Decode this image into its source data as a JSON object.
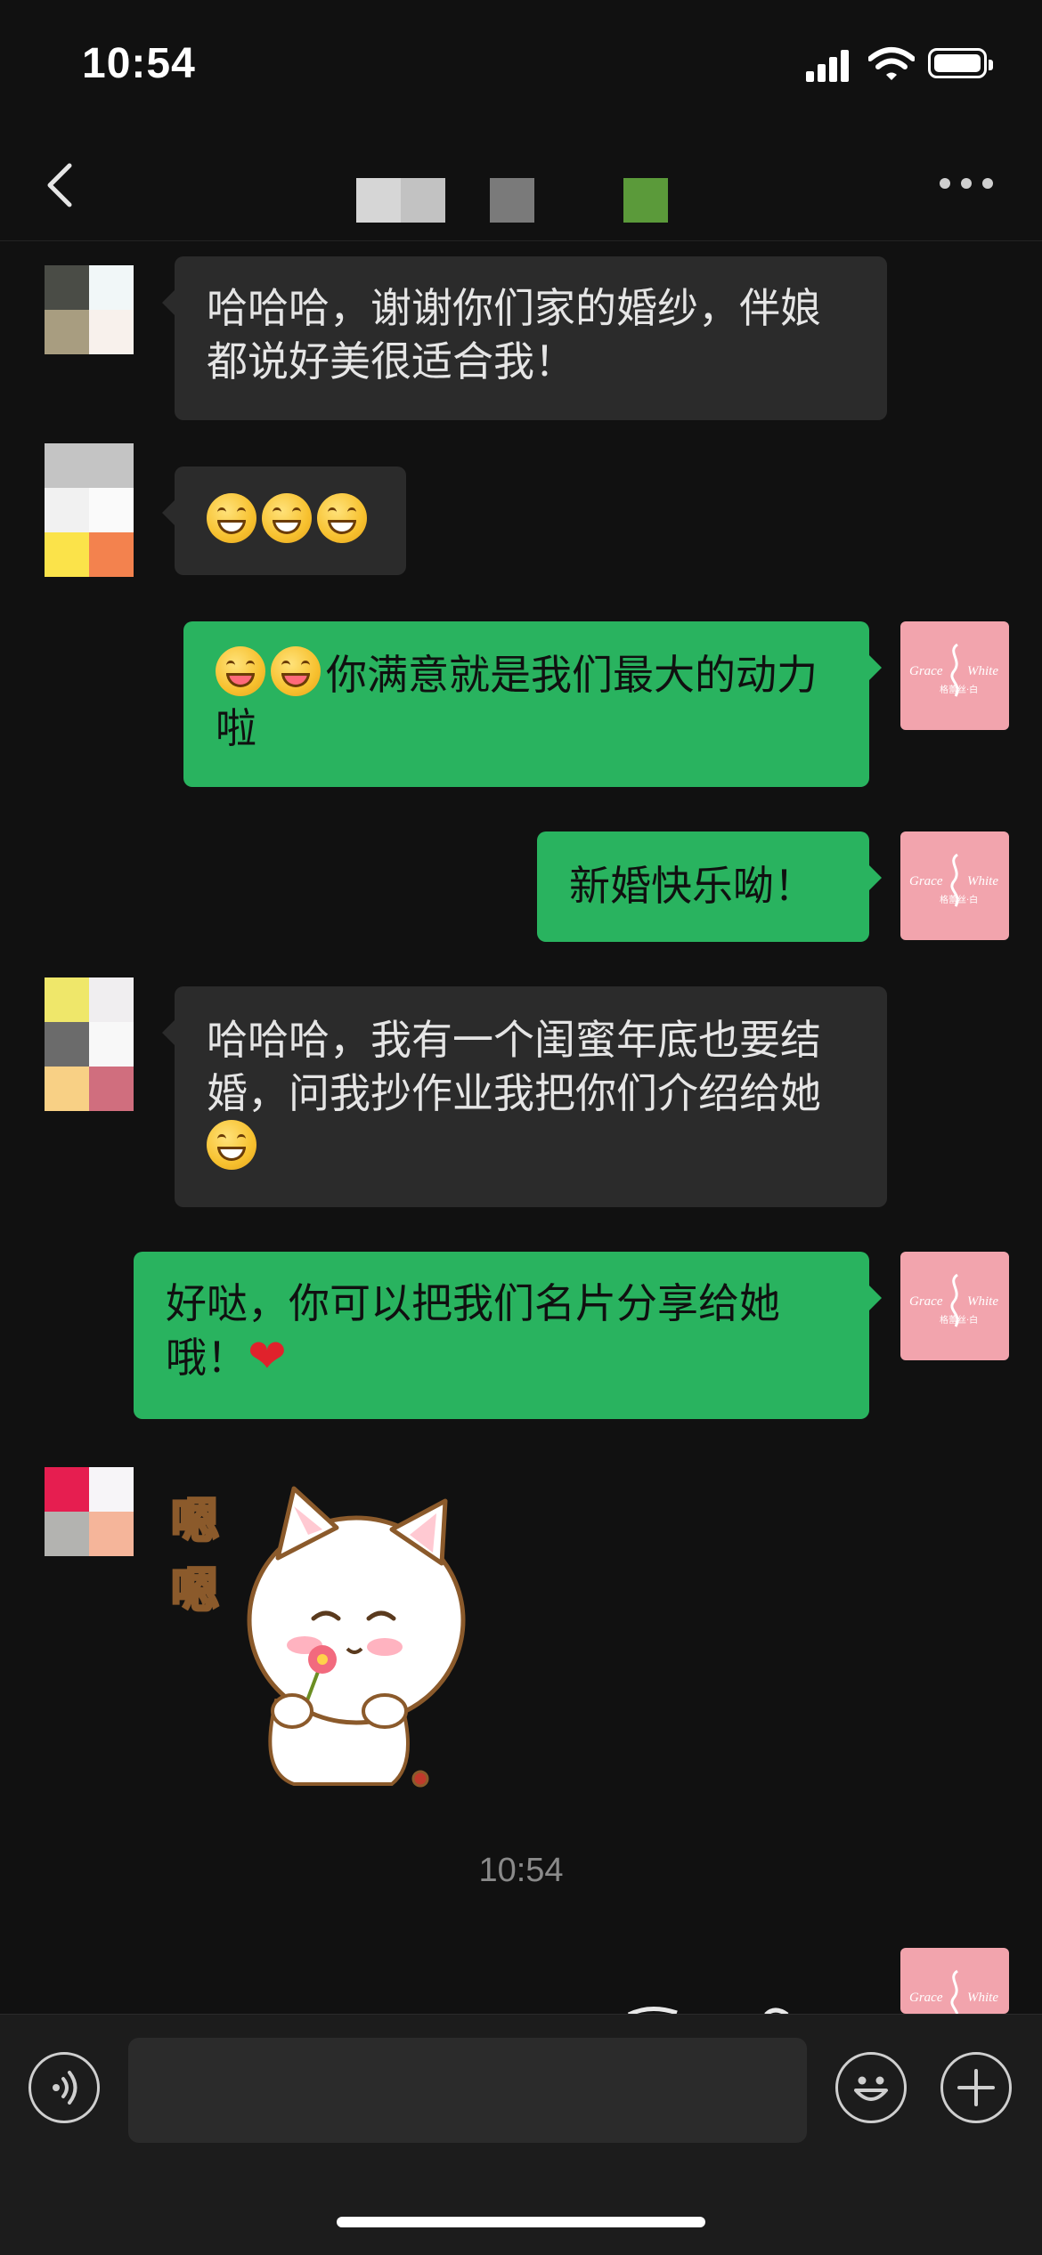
{
  "status_bar": {
    "time": "10:54"
  },
  "nav": {
    "title_blocks": [
      "#d6d6d6",
      "#c2c2c2",
      "#7a7a7a",
      "#5b9a3a"
    ]
  },
  "messages": [
    {
      "side": "in",
      "text": "哈哈哈，谢谢你们家的婚纱，伴娘都说好美很适合我！"
    },
    {
      "side": "in",
      "emoji": [
        "grin-emoji",
        "grin-emoji",
        "grin-emoji"
      ]
    },
    {
      "side": "out",
      "emoji": [
        "wink-tongue-emoji",
        "wink-tongue-emoji"
      ],
      "text": "你满意就是我们最大的动力啦"
    },
    {
      "side": "out",
      "text": "新婚快乐呦！"
    },
    {
      "side": "in",
      "text": "哈哈哈，我有一个闺蜜年底也要结婚，问我抄作业我把你们介绍给她",
      "emoji_after": "grin-emoji"
    },
    {
      "side": "out",
      "text": "好哒，你可以把我们名片分享给她哦！",
      "emoji_after": "heart"
    },
    {
      "side": "in",
      "sticker": {
        "text": "嗯嗯"
      }
    }
  ],
  "timestamp": "10:54",
  "brand_avatar": {
    "name_left": "Grace",
    "name_right": "White",
    "cn": "格蕾丝·白",
    "color": "#f2a4ad"
  },
  "input": {
    "placeholder": ""
  },
  "colors": {
    "background": "#111111",
    "bubble_in": "#2b2b2b",
    "bubble_out": "#29b35f"
  }
}
